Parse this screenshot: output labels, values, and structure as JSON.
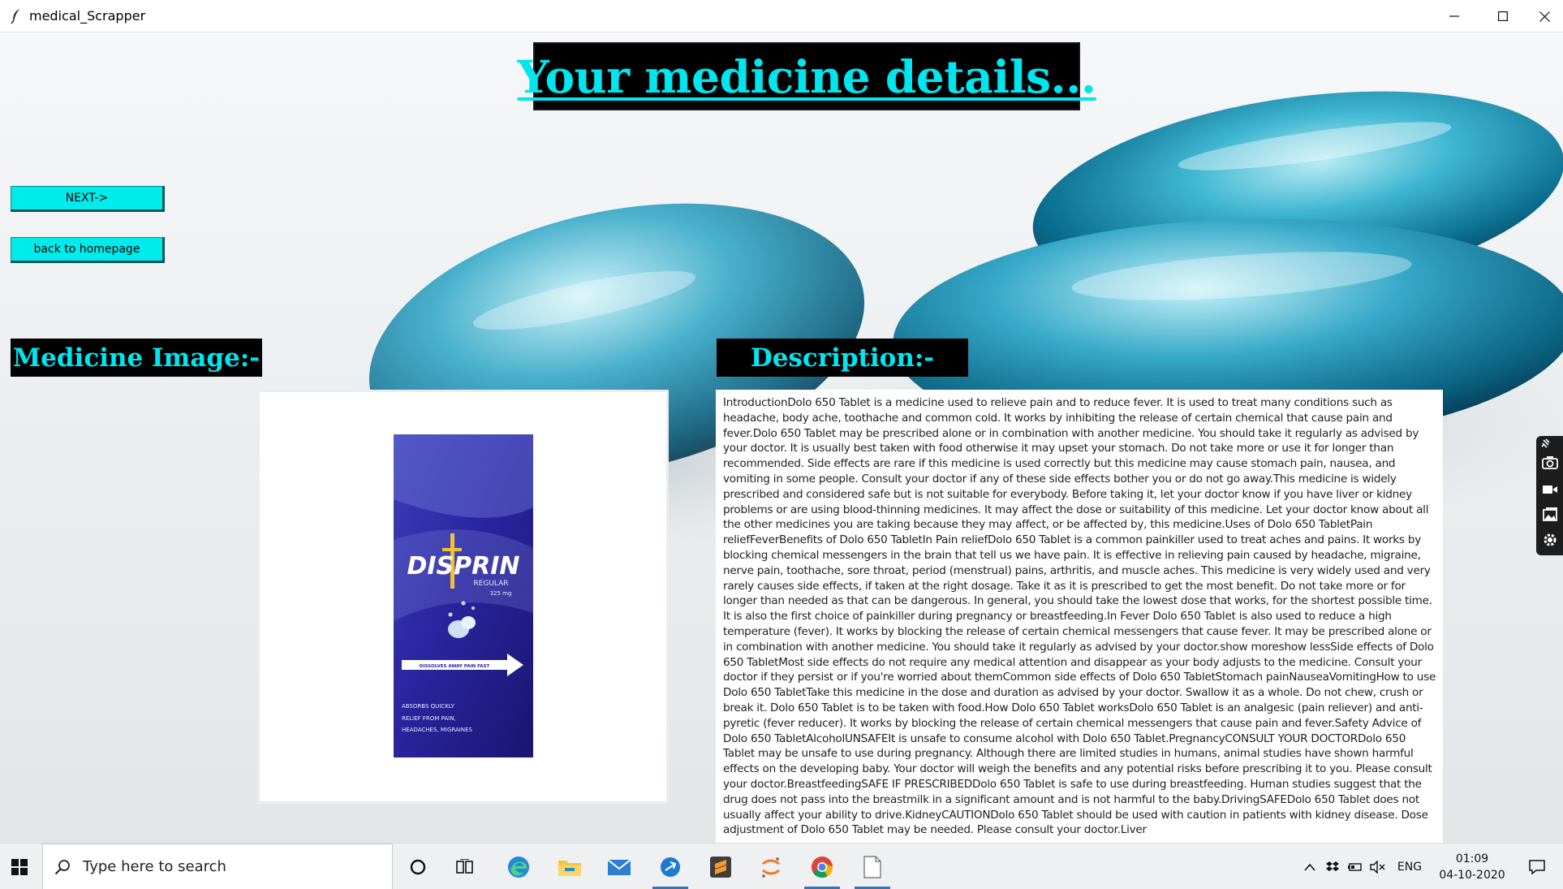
{
  "window": {
    "title": "medical_Scrapper",
    "controls": [
      "minimize-icon",
      "maximize-icon",
      "close-icon"
    ]
  },
  "page": {
    "heading": "Your medicine details...",
    "buttons": {
      "next": "NEXT->",
      "back": "back to homepage"
    },
    "image_section_label": "Medicine Image:-",
    "description_section_label": "Description:-",
    "description_text": "IntroductionDolo 650 Tablet is a medicine used to relieve pain and to reduce fever. It is used to treat many conditions such as headache, body ache, toothache and common cold. It works by inhibiting the release of certain chemical that cause pain and fever.Dolo 650 Tablet may be prescribed alone or in combination with another medicine. You should take it regularly as advised by your doctor. It is usually best taken with food otherwise it may upset your stomach. Do not take more or use it for longer than recommended. Side effects are rare if this medicine is used correctly but this medicine may cause stomach pain, nausea, and vomiting in some people. Consult your doctor if any of these side effects bother you or do not go away.This medicine is widely prescribed and considered safe but is not suitable for everybody. Before taking it, let your doctor know if you have liver or kidney problems or are using blood-thinning medicines. It may affect the dose or suitability of this medicine. Let your doctor know about all the other medicines you are taking because they may affect, or be affected by, this medicine.Uses of Dolo 650 TabletPain reliefFeverBenefits of Dolo 650 TabletIn Pain reliefDolo 650 Tablet is a common painkiller used to treat aches and pains. It works by blocking chemical messengers in the brain that tell us we have pain. It is effective in relieving pain caused by headache, migraine, nerve pain, toothache, sore throat, period (menstrual) pains, arthritis, and muscle aches. This medicine is very widely used and very rarely causes side effects, if taken at the right dosage. Take it as it is prescribed to get the most benefit. Do not take more or for longer than needed as that can be dangerous. In general, you should take the lowest dose that works, for the shortest possible time. It is also the first choice of painkiller during pregnancy or breastfeeding.In Fever Dolo 650 Tablet is also used to reduce a high temperature (fever). It works by blocking the release of certain chemical messengers that cause fever. It may be prescribed alone or in combination with another medicine. You should take it regularly as advised by your doctor.show moreshow lessSide effects of Dolo 650 TabletMost side effects do not require any medical attention and disappear as your body adjusts to the medicine. Consult your doctor if they persist or if you're worried about themCommon side effects of Dolo 650 TabletStomach painNauseaVomitingHow to use Dolo 650 TabletTake this medicine in the dose and duration as advised by your doctor. Swallow it as a whole. Do not chew, crush or break it. Dolo 650 Tablet is to be taken with food.How Dolo 650 Tablet worksDolo 650 Tablet is an analgesic (pain reliever) and anti-pyretic (fever reducer). It works by blocking the release of certain chemical messengers that cause pain and fever.Safety Advice of Dolo 650 TabletAlcoholUNSAFEIt is unsafe to consume alcohol with Dolo 650 Tablet.PregnancyCONSULT YOUR DOCTORDolo 650 Tablet may be unsafe to use during pregnancy. Although there are limited studies in humans, animal studies have shown harmful effects on the developing baby. Your doctor will weigh the benefits and any potential risks before prescribing it to you. Please consult your doctor.BreastfeedingSAFE IF PRESCRIBEDDolo 650 Tablet is safe to use during breastfeeding. Human studies suggest that the drug does not pass into the breastmilk in a significant amount and is not harmful to the baby.DrivingSAFEDolo 650 Tablet does not usually affect your ability to drive.KidneyCAUTIONDolo 650 Tablet should be used with caution in patients with kidney disease. Dose adjustment of Dolo 650 Tablet may be needed. Please consult your doctor.Liver",
    "product_image": {
      "brand": "DISPRIN",
      "variant": "REGULAR",
      "strength": "325 mg",
      "banner": "DISSOLVES AWAY PAIN FAST",
      "claims": [
        "ABSORBS QUICKLY",
        "RELIEF FROM PAIN,",
        "HEADACHES, MIGRAINES"
      ]
    }
  },
  "capture_toolbar": {
    "icons": [
      "pin-icon",
      "camera-icon",
      "video-icon",
      "gallery-icon",
      "settings-icon"
    ]
  },
  "taskbar": {
    "search_placeholder": "Type here to search",
    "apps": [
      "cortana-icon",
      "task-view-icon",
      "edge-icon",
      "file-explorer-icon",
      "mail-icon",
      "app-blue-icon",
      "sublime-text-icon",
      "jupyter-icon",
      "chrome-icon",
      "notepad-icon"
    ],
    "tray": {
      "language": "ENG",
      "time": "01:09",
      "date": "04-10-2020"
    }
  },
  "colors": {
    "accent_cyan": "#00e5ee",
    "button_cyan": "#00ecec",
    "label_bg": "#000000"
  }
}
